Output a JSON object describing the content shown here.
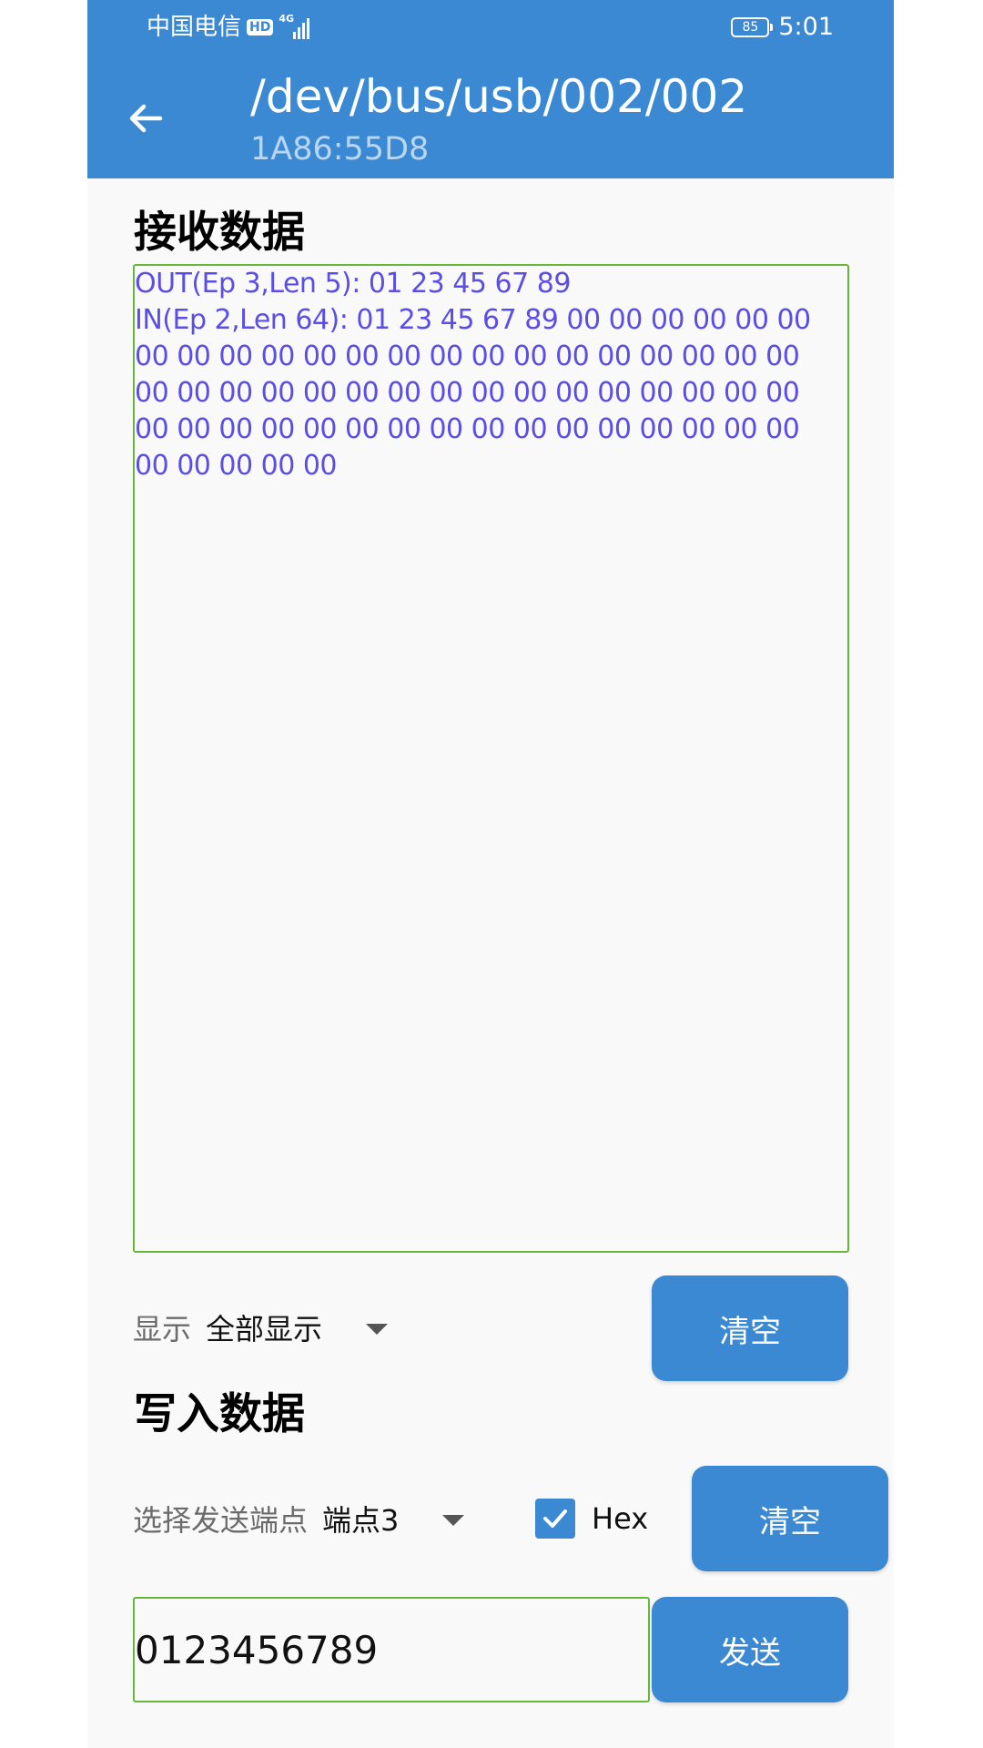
{
  "status_bar": {
    "carrier": "中国电信",
    "hd_badge": "HD",
    "network": "4G",
    "battery": "85",
    "time": "5:01",
    "icons": [
      "hd-icon",
      "signal-icon",
      "battery-icon"
    ]
  },
  "app_bar": {
    "back_icon": "arrow-left-icon",
    "title": "/dev/bus/usb/002/002",
    "subtitle": "1A86:55D8"
  },
  "receive": {
    "heading": "接收数据",
    "log": "OUT(Ep 3,Len 5): 01 23 45 67 89\nIN(Ep 2,Len 64): 01 23 45 67 89 00 00 00 00 00 00\n00 00 00 00 00 00 00 00 00 00 00 00 00 00 00 00\n00 00 00 00 00 00 00 00 00 00 00 00 00 00 00 00\n00 00 00 00 00 00 00 00 00 00 00 00 00 00 00 00\n00 00 00 00 00",
    "display_label": "显示",
    "display_value": "全部显示",
    "clear_label": "清空"
  },
  "write": {
    "heading": "写入数据",
    "endpoint_label": "选择发送端点",
    "endpoint_value": "端点3",
    "hex_label": "Hex",
    "hex_checked": true,
    "clear_label": "清空",
    "input_value": "0123456789",
    "send_label": "发送"
  },
  "colors": {
    "primary": "#3b88d3",
    "border_green": "#67b73a",
    "log_text": "#5a4ee6"
  }
}
